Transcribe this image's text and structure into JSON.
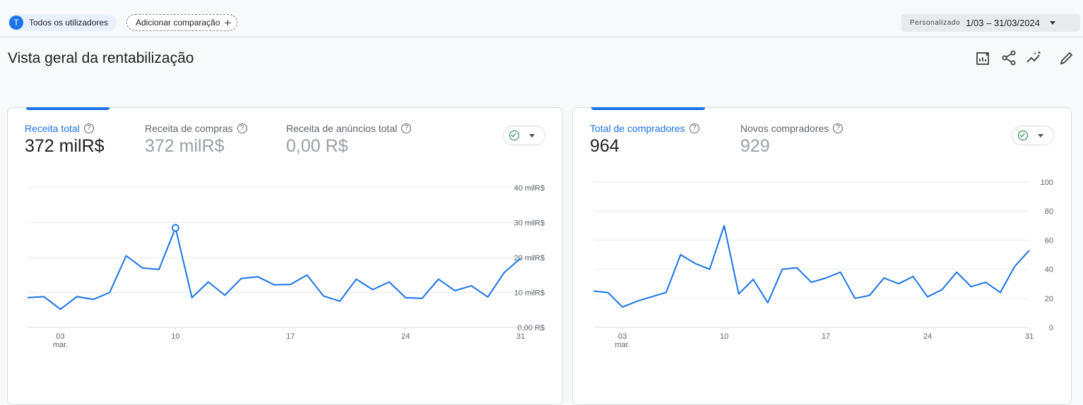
{
  "header": {
    "segment_avatar": "T",
    "segment_label": "Todos os utilizadores",
    "add_comparison_label": "Adicionar comparação",
    "date_range_label": "Personalizado",
    "date_range_value": "1/03 – 31/03/2024"
  },
  "page": {
    "title": "Vista geral da rentabilização"
  },
  "toolbar": {
    "icons": [
      "edit-report-icon",
      "share-icon",
      "insights-icon",
      "pencil-icon"
    ]
  },
  "cards": [
    {
      "metrics": [
        {
          "label": "Receita total",
          "value": "372 milR$",
          "active": true
        },
        {
          "label": "Receita de compras",
          "value": "372 milR$",
          "active": false
        },
        {
          "label": "Receita de anúncios total",
          "value": "0,00 R$",
          "active": false
        }
      ],
      "status_color": "#188038"
    },
    {
      "metrics": [
        {
          "label": "Total de compradores",
          "value": "964",
          "active": true
        },
        {
          "label": "Novos compradores",
          "value": "929",
          "active": false
        }
      ],
      "status_color": "#188038"
    }
  ],
  "chart_data": [
    {
      "type": "line",
      "series": [
        {
          "values": [
            8500,
            8800,
            5200,
            8800,
            8000,
            10000,
            20500,
            17000,
            16600,
            28500,
            8500,
            13000,
            9200,
            14000,
            14500,
            12200,
            12300,
            15000,
            9000,
            7500,
            13800,
            10800,
            13000,
            8500,
            8300,
            13800,
            10500,
            11900,
            8700,
            15700,
            19800
          ]
        }
      ],
      "x": [
        1,
        2,
        3,
        4,
        5,
        6,
        7,
        8,
        9,
        10,
        11,
        12,
        13,
        14,
        15,
        16,
        17,
        18,
        19,
        20,
        21,
        22,
        23,
        24,
        25,
        26,
        27,
        28,
        29,
        30,
        31
      ],
      "x_ticks": [
        {
          "day": 3,
          "label": "03",
          "sub": "mar."
        },
        {
          "day": 10,
          "label": "10"
        },
        {
          "day": 17,
          "label": "17"
        },
        {
          "day": 24,
          "label": "24"
        },
        {
          "day": 31,
          "label": "31"
        }
      ],
      "y_ticks": [
        "0,00 R$",
        "10 milR$",
        "20 milR$",
        "30 milR$",
        "40 milR$"
      ],
      "ylim": [
        0,
        40000
      ],
      "highlight_day": 10,
      "line_color": "#1a73e8",
      "grid": true
    },
    {
      "type": "line",
      "series": [
        {
          "values": [
            25,
            24,
            14,
            18,
            21,
            24,
            50,
            44,
            40,
            70,
            23,
            33,
            17,
            40,
            41,
            31,
            34,
            38,
            20,
            22,
            34,
            30,
            35,
            21,
            26,
            38,
            28,
            31,
            24,
            42,
            53
          ]
        }
      ],
      "x": [
        1,
        2,
        3,
        4,
        5,
        6,
        7,
        8,
        9,
        10,
        11,
        12,
        13,
        14,
        15,
        16,
        17,
        18,
        19,
        20,
        21,
        22,
        23,
        24,
        25,
        26,
        27,
        28,
        29,
        30,
        31
      ],
      "x_ticks": [
        {
          "day": 3,
          "label": "03",
          "sub": "mar."
        },
        {
          "day": 10,
          "label": "10"
        },
        {
          "day": 17,
          "label": "17"
        },
        {
          "day": 24,
          "label": "24"
        },
        {
          "day": 31,
          "label": "31"
        }
      ],
      "y_ticks": [
        "0",
        "20",
        "40",
        "60",
        "80",
        "100"
      ],
      "ylim": [
        0,
        100
      ],
      "line_color": "#1a73e8",
      "grid": true
    }
  ]
}
